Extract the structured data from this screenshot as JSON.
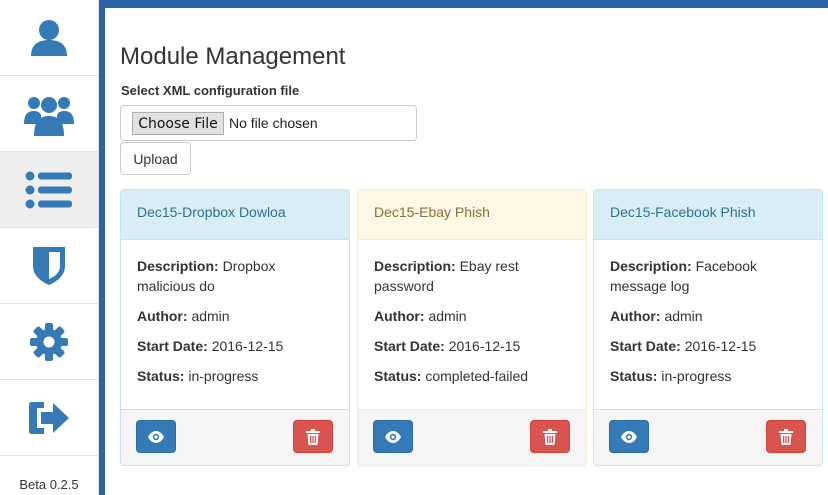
{
  "sidebar": {
    "items": [
      {
        "icon": "user-icon",
        "active": false
      },
      {
        "icon": "users-group-icon",
        "active": false
      },
      {
        "icon": "list-icon",
        "active": true
      },
      {
        "icon": "shield-icon",
        "active": false
      },
      {
        "icon": "gear-icon",
        "active": false
      },
      {
        "icon": "sign-out-icon",
        "active": false
      }
    ],
    "version": "Beta 0.2.5",
    "icon_color": "#337ab7"
  },
  "page": {
    "title": "Module Management"
  },
  "upload_form": {
    "label": "Select XML configuration file",
    "choose_button": "Choose File",
    "file_status": "No file chosen",
    "upload_button": "Upload"
  },
  "modules": [
    {
      "name": "Dec15-Dropbox Dowloa",
      "style": "info",
      "description_label": "Description:",
      "description": "Dropbox malicious do",
      "author_label": "Author:",
      "author": "admin",
      "start_label": "Start Date:",
      "start_date": "2016-12-15",
      "status_label": "Status:",
      "status": "in-progress"
    },
    {
      "name": "Dec15-Ebay Phish",
      "style": "warning",
      "description_label": "Description:",
      "description": "Ebay rest password",
      "author_label": "Author:",
      "author": "admin",
      "start_label": "Start Date:",
      "start_date": "2016-12-15",
      "status_label": "Status:",
      "status": "completed-failed"
    },
    {
      "name": "Dec15-Facebook Phish",
      "style": "info",
      "description_label": "Description:",
      "description": "Facebook message log",
      "author_label": "Author:",
      "author": "admin",
      "start_label": "Start Date:",
      "start_date": "2016-12-15",
      "status_label": "Status:",
      "status": "in-progress"
    }
  ],
  "colors": {
    "brand_blue": "#2b62a8",
    "primary": "#337ab7",
    "danger": "#d9534f",
    "info_bg": "#d9edf7",
    "warning_bg": "#fcf8e3"
  }
}
